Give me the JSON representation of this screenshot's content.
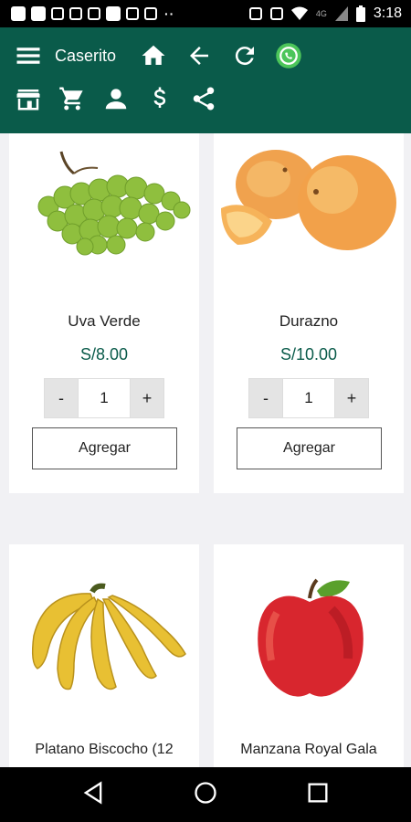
{
  "status_bar": {
    "time": "3:18",
    "network": "4G"
  },
  "app": {
    "title": "Caserito"
  },
  "toolbar": {
    "row1": [
      "menu-icon",
      "home-icon",
      "back-arrow-icon",
      "refresh-icon",
      "whatsapp-icon"
    ],
    "row2": [
      "store-icon",
      "cart-icon",
      "user-icon",
      "dollar-icon",
      "share-icon"
    ]
  },
  "products": [
    {
      "name": "Uva Verde",
      "price": "S/8.00",
      "qty": "1",
      "add_label": "Agregar",
      "minus": "-",
      "plus": "+"
    },
    {
      "name": "Durazno",
      "price": "S/10.00",
      "qty": "1",
      "add_label": "Agregar",
      "minus": "-",
      "plus": "+"
    },
    {
      "name": "Platano Biscocho (12",
      "price": "",
      "qty": "",
      "add_label": "",
      "minus": "",
      "plus": ""
    },
    {
      "name": "Manzana Royal Gala",
      "price": "",
      "qty": "",
      "add_label": "",
      "minus": "",
      "plus": ""
    }
  ],
  "colors": {
    "primary": "#0a5b4a",
    "background": "#f1f1f4"
  }
}
